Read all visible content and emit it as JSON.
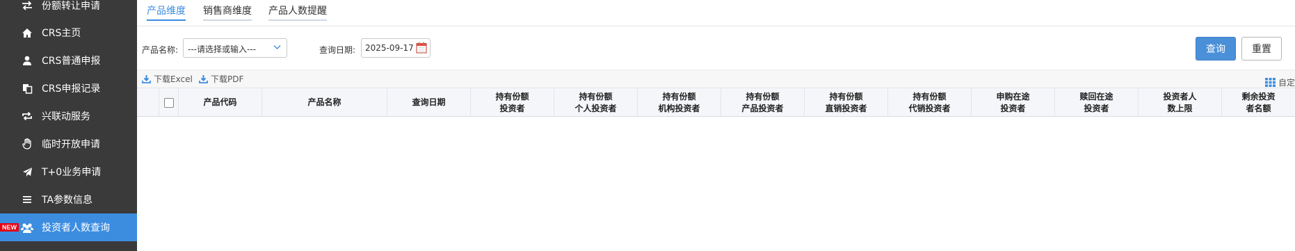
{
  "sidebar": {
    "items": [
      {
        "label": "份额转让申请",
        "icon": "transfer-icon"
      },
      {
        "label": "CRS主页",
        "icon": "home-icon"
      },
      {
        "label": "CRS普通申报",
        "icon": "user-icon"
      },
      {
        "label": "CRS申报记录",
        "icon": "document-copy-icon"
      },
      {
        "label": "兴联动服务",
        "icon": "sync-icon"
      },
      {
        "label": "临时开放申请",
        "icon": "hand-icon"
      },
      {
        "label": "T+0业务申请",
        "icon": "send-icon"
      },
      {
        "label": "TA参数信息",
        "icon": "list-icon"
      },
      {
        "label": "投资者人数查询",
        "icon": "users-icon",
        "badge": "NEW",
        "active": true
      }
    ]
  },
  "tabs": [
    {
      "label": "产品维度",
      "active": true
    },
    {
      "label": "销售商维度",
      "active": false
    },
    {
      "label": "产品人数提醒",
      "active": false
    }
  ],
  "filters": {
    "product_label": "产品名称:",
    "product_placeholder": "---请选择或输入---",
    "date_label": "查询日期:",
    "date_value": "2025-09-17",
    "query_button": "查询",
    "reset_button": "重置"
  },
  "toolbar": {
    "excel": "下载Excel",
    "pdf": "下载PDF",
    "custom": "自定"
  },
  "table": {
    "columns": [
      {
        "line1": "产品代码",
        "line2": ""
      },
      {
        "line1": "产品名称",
        "line2": ""
      },
      {
        "line1": "查询日期",
        "line2": ""
      },
      {
        "line1": "持有份额",
        "line2": "投资者"
      },
      {
        "line1": "持有份额",
        "line2": "个人投资者"
      },
      {
        "line1": "持有份额",
        "line2": "机构投资者"
      },
      {
        "line1": "持有份额",
        "line2": "产品投资者"
      },
      {
        "line1": "持有份额",
        "line2": "直销投资者"
      },
      {
        "line1": "持有份额",
        "line2": "代销投资者"
      },
      {
        "line1": "申购在途",
        "line2": "投资者"
      },
      {
        "line1": "赎回在途",
        "line2": "投资者"
      },
      {
        "line1": "投资者人",
        "line2": "数上限"
      },
      {
        "line1": "剩余投资",
        "line2": "者名额"
      }
    ]
  },
  "colors": {
    "sidebar_bg": "#3a3a3a",
    "accent": "#3c8de0",
    "badge_red": "#e60012"
  }
}
